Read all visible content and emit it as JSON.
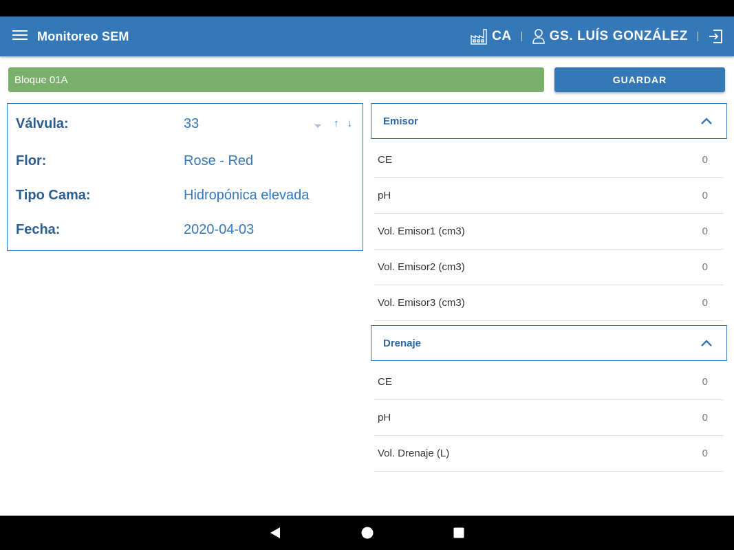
{
  "app": {
    "title": "Monitoreo SEM",
    "site_code": "CA",
    "user_name": "GS. LUÍS GONZÁLEZ"
  },
  "icons": {
    "menu": "menu-icon",
    "site": "factory-icon",
    "user": "user-icon",
    "logout": "logout-icon",
    "chevron": "chevron-up-icon",
    "dropdown": "dropdown-arrow-icon",
    "sort": "sort-arrows-icon"
  },
  "colors": {
    "primary": "#3578b7",
    "bloque_bg": "#7aaf6c"
  },
  "bloque": {
    "label": "Bloque 01A"
  },
  "actions": {
    "save_label": "GUARDAR"
  },
  "info": {
    "valvula": {
      "label": "Válvula:",
      "value": "33",
      "sort": "↑ ↓"
    },
    "flor": {
      "label": "Flor:",
      "value": "Rose - Red"
    },
    "tipo_cama": {
      "label": "Tipo Cama:",
      "value": "Hidropónica elevada"
    },
    "fecha": {
      "label": "Fecha:",
      "value": "2020-04-03"
    }
  },
  "emisor": {
    "title": "Emisor",
    "rows": [
      {
        "label": "CE",
        "value": "0"
      },
      {
        "label": "pH",
        "value": "0"
      },
      {
        "label": "Vol. Emisor1 (cm3)",
        "value": "0"
      },
      {
        "label": "Vol. Emisor2 (cm3)",
        "value": "0"
      },
      {
        "label": "Vol. Emisor3 (cm3)",
        "value": "0"
      }
    ]
  },
  "drenaje": {
    "title": "Drenaje",
    "rows": [
      {
        "label": "CE",
        "value": "0"
      },
      {
        "label": "pH",
        "value": "0"
      },
      {
        "label": "Vol. Drenaje (L)",
        "value": "0"
      }
    ]
  }
}
